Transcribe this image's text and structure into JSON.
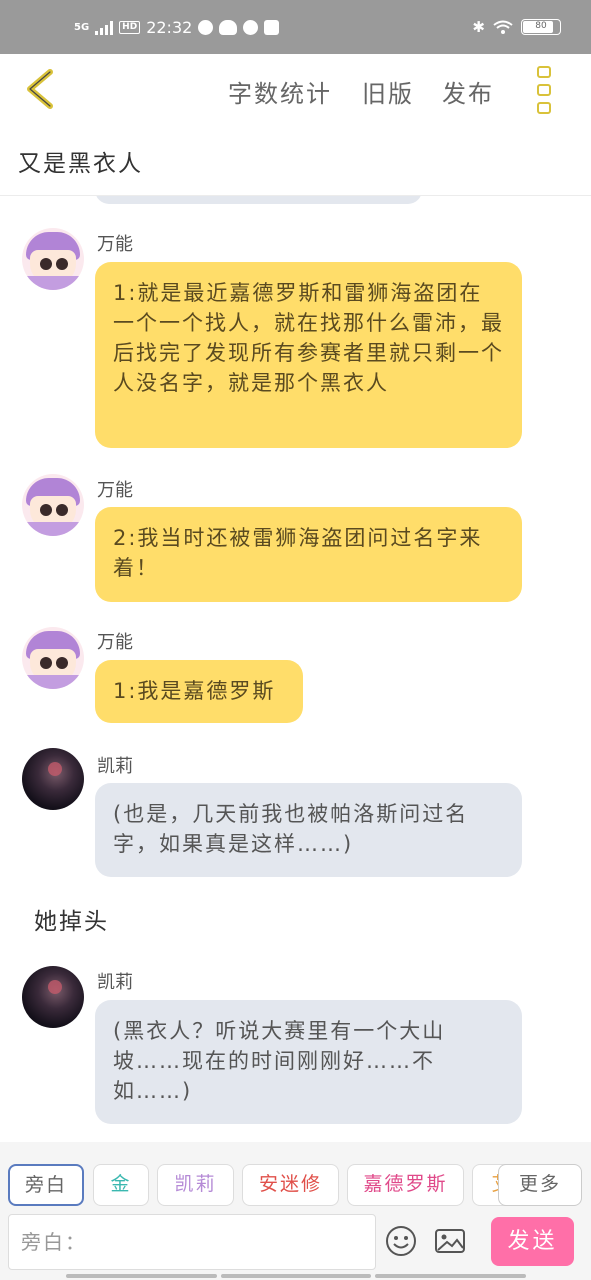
{
  "status_bar": {
    "time": "22:32",
    "network": "5G",
    "hd": "HD",
    "battery": "80"
  },
  "top_bar": {
    "word_count": "字数统计",
    "old_version": "旧版",
    "publish": "发布"
  },
  "chapter_title": "又是黑衣人",
  "messages": [
    {
      "name": "万能",
      "text": "1:就是最近嘉德罗斯和雷狮海盗团在一个一个找人，就在找那什么雷沛，最后找完了发现所有参赛者里就只剩一个人没名字，就是那个黑衣人"
    },
    {
      "name": "万能",
      "text": "2:我当时还被雷狮海盗团问过名字来着！"
    },
    {
      "name": "万能",
      "text": "1:我是嘉德罗斯"
    },
    {
      "name": "凯莉",
      "text": "(也是，几天前我也被帕洛斯问过名字，如果真是这样……)"
    },
    {
      "name": "凯莉",
      "text": "(黑衣人？听说大赛里有一个大山坡……现在的时间刚刚好……不如……)"
    }
  ],
  "narration": "她掉头",
  "role_chips": [
    {
      "label": "旁白",
      "color": "#666666"
    },
    {
      "label": "金",
      "color": "#3bb8b0"
    },
    {
      "label": "凯莉",
      "color": "#b58ad6"
    },
    {
      "label": "安迷修",
      "color": "#e0504a"
    },
    {
      "label": "嘉德罗斯",
      "color": "#e04a8a"
    },
    {
      "label": "艾",
      "color": "#e8a040"
    }
  ],
  "more_label": "更多",
  "input": {
    "placeholder": "旁白："
  },
  "send_label": "发送"
}
